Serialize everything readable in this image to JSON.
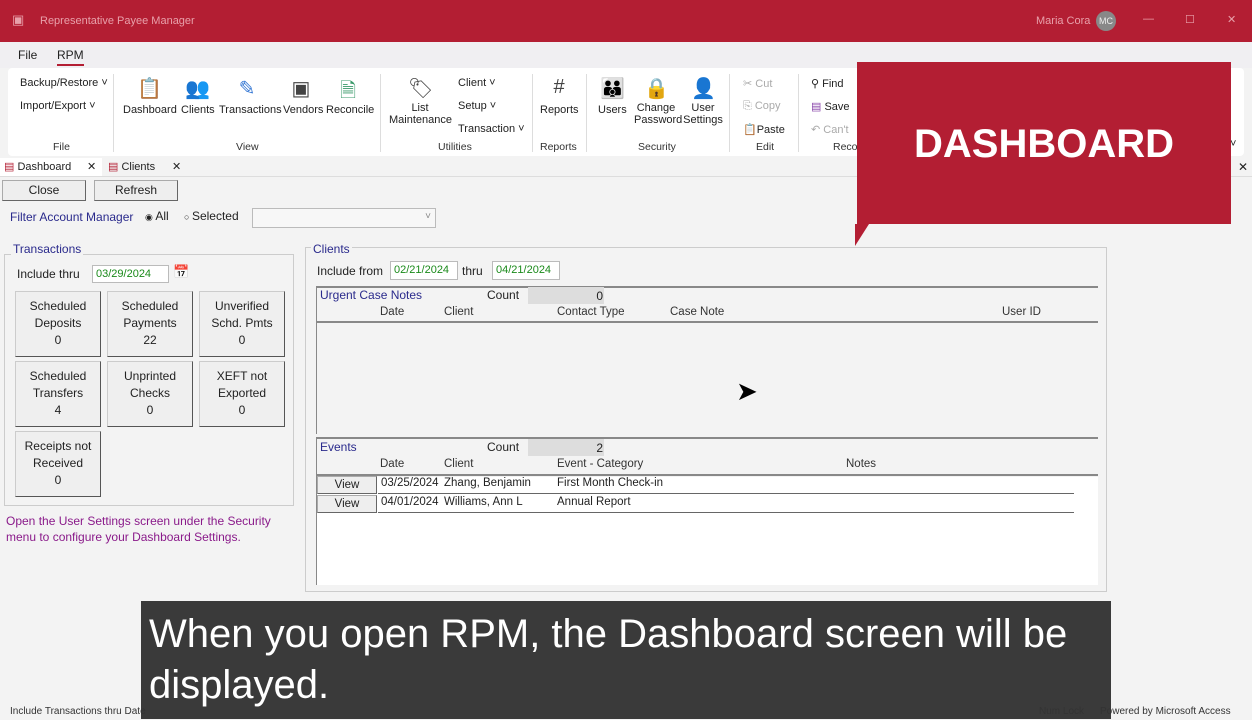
{
  "window": {
    "title": "Representative Payee Manager",
    "user": "Maria Cora",
    "initials": "MC",
    "minimize": "—",
    "maximize": "☐",
    "close": "✕"
  },
  "menu": [
    "File",
    "RPM"
  ],
  "ribbon": {
    "file": {
      "items": [
        "Backup/Restore ˅",
        "Import/Export ˅"
      ],
      "group": "File"
    },
    "view": {
      "items": [
        "Dashboard",
        "Clients",
        "Transactions",
        "Vendors",
        "Reconcile"
      ],
      "group": "View"
    },
    "utilities": {
      "list1": "List",
      "list2": "Maintenance",
      "items": [
        "Client ˅",
        "Setup ˅",
        "Transaction ˅"
      ],
      "group": "Utilities"
    },
    "reports": {
      "item": "Reports",
      "group": "Reports"
    },
    "security": {
      "users": "Users",
      "cp1": "Change",
      "cp2": "Password",
      "us1": "User",
      "us2": "Settings",
      "group": "Security"
    },
    "edit": {
      "items": [
        "Cut",
        "Copy",
        "Paste"
      ],
      "group": "Edit"
    },
    "records": {
      "items": [
        "Find",
        "Save",
        "Can't"
      ],
      "group": "Reco"
    }
  },
  "tabs": [
    {
      "label": "Dashboard"
    },
    {
      "label": "Clients"
    }
  ],
  "toolbar": {
    "close": "Close",
    "refresh": "Refresh"
  },
  "filter": {
    "label": "Filter Account Manager",
    "all": "All",
    "selected": "Selected"
  },
  "transactions": {
    "title": "Transactions",
    "include_label": "Include thru",
    "include_value": "03/29/2024",
    "tiles": [
      {
        "l1": "Scheduled",
        "l2": "Deposits",
        "v": "0"
      },
      {
        "l1": "Scheduled",
        "l2": "Payments",
        "v": "22"
      },
      {
        "l1": "Unverified",
        "l2": "Schd. Pmts",
        "v": "0"
      },
      {
        "l1": "Scheduled",
        "l2": "Transfers",
        "v": "4"
      },
      {
        "l1": "Unprinted",
        "l2": "Checks",
        "v": "0"
      },
      {
        "l1": "XEFT not",
        "l2": "Exported",
        "v": "0"
      },
      {
        "l1": "Receipts not",
        "l2": "Received",
        "v": "0"
      }
    ],
    "hint": "Open the User Settings screen under the Security menu to configure your Dashboard Settings."
  },
  "clients": {
    "title": "Clients",
    "from_label": "Include from",
    "from": "02/21/2024",
    "thru_label": "thru",
    "thru": "04/21/2024",
    "urgent": {
      "title": "Urgent Case Notes",
      "count_label": "Count",
      "count": "0",
      "cols": [
        "Date",
        "Client",
        "Contact Type",
        "Case Note",
        "User ID"
      ]
    },
    "events": {
      "title": "Events",
      "count_label": "Count",
      "count": "2",
      "cols": [
        "Date",
        "Client",
        "Event - Category",
        "Notes"
      ],
      "rows": [
        {
          "btn": "View",
          "date": "03/25/2024",
          "client": "Zhang, Benjamin",
          "cat": "First Month Check-in"
        },
        {
          "btn": "View",
          "date": "04/01/2024",
          "client": "Williams, Ann L",
          "cat": "Annual Report"
        }
      ]
    }
  },
  "overlay": "DASHBOARD",
  "caption": "When you open RPM, the Dashboard screen will be displayed.",
  "status": {
    "left": "Include Transactions thru Date",
    "numlock": "Num Lock",
    "powered": "Powered by Microsoft Access"
  }
}
